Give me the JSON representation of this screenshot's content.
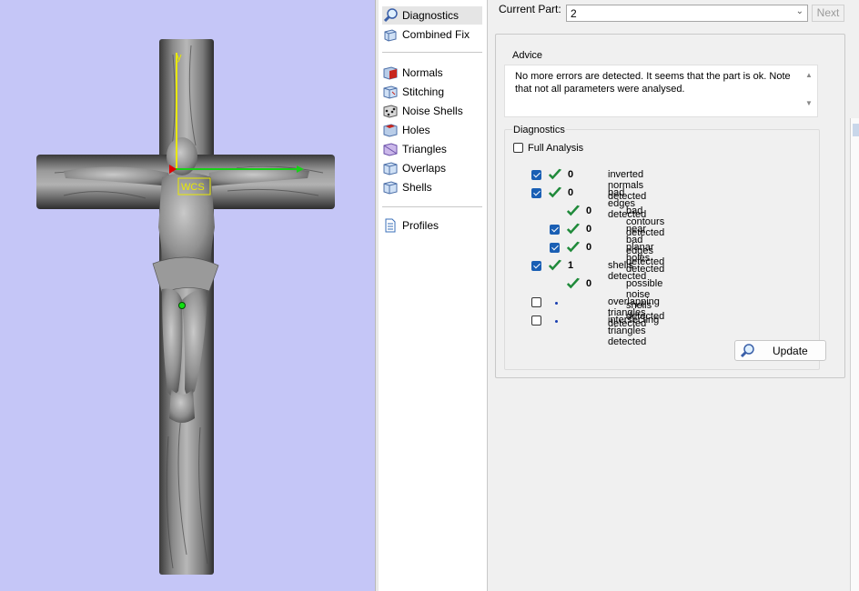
{
  "viewport": {
    "background": "#c5c6f7",
    "wcs_label": "WCS",
    "y_axis_label": "y"
  },
  "tools": [
    {
      "label": "Diagnostics",
      "icon": "magnifier-icon",
      "selected": true
    },
    {
      "label": "Combined Fix",
      "icon": "cube-icon"
    },
    {
      "label": "Normals",
      "icon": "normals-cube-icon"
    },
    {
      "label": "Stitching",
      "icon": "stitching-cube-icon"
    },
    {
      "label": "Noise Shells",
      "icon": "noise-shells-cube-icon"
    },
    {
      "label": "Holes",
      "icon": "holes-cube-icon"
    },
    {
      "label": "Triangles",
      "icon": "triangles-cube-icon"
    },
    {
      "label": "Overlaps",
      "icon": "overlaps-cube-icon"
    },
    {
      "label": "Shells",
      "icon": "shells-cube-icon"
    },
    {
      "label": "Profiles",
      "icon": "document-icon"
    }
  ],
  "header": {
    "current_part_label": "Current Part:",
    "current_part_value": "2",
    "next_label": "Next"
  },
  "advice": {
    "title": "Advice",
    "text": "No more errors are detected. It seems that the part is ok. Note that not all parameters were analysed."
  },
  "diagnostics": {
    "title": "Diagnostics",
    "full_analysis_label": "Full Analysis",
    "full_analysis_checked": false,
    "rows": [
      {
        "checkbox": true,
        "status": "ok",
        "count": "0",
        "label": "inverted normals detected",
        "indent": 0
      },
      {
        "checkbox": true,
        "status": "ok",
        "count": "0",
        "label": "bad edges detected",
        "indent": 0
      },
      {
        "checkbox": null,
        "status": "ok",
        "count": "0",
        "label": "bad contours detected",
        "indent": 1
      },
      {
        "checkbox": true,
        "status": "ok",
        "count": "0",
        "label": "near bad edges detected",
        "indent": 1
      },
      {
        "checkbox": true,
        "status": "ok",
        "count": "0",
        "label": "planar holes detected",
        "indent": 1
      },
      {
        "checkbox": true,
        "status": "ok",
        "count": "1",
        "label": "shells detected",
        "indent": 0
      },
      {
        "checkbox": null,
        "status": "ok",
        "count": "0",
        "label": "possible noise shells detected",
        "indent": 1
      },
      {
        "checkbox": false,
        "status": "none",
        "count": "",
        "label": "overlapping triangles detected",
        "indent": 0
      },
      {
        "checkbox": false,
        "status": "none",
        "count": "",
        "label": "intersecting triangles detected",
        "indent": 0
      }
    ],
    "update_label": "Update"
  },
  "colors": {
    "checkbox_blue": "#1a5fb4",
    "check_green": "#1f8a3a",
    "dot_blue": "#1a3fb0"
  }
}
